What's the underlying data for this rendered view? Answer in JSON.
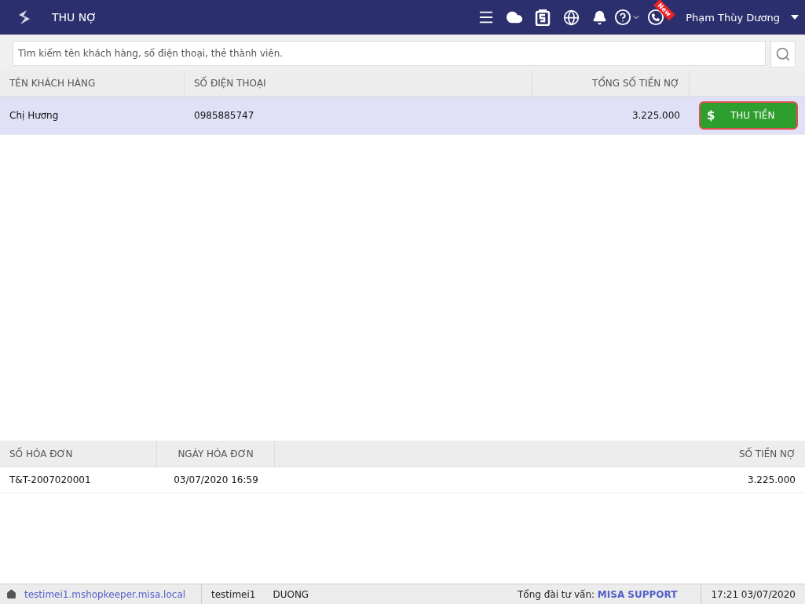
{
  "header": {
    "title": "THU NỢ",
    "new_badge": "New",
    "user_name": "Phạm Thùy Dương"
  },
  "search": {
    "placeholder": "Tìm kiếm tên khách hàng, số điện thoại, thẻ thành viên."
  },
  "customers": {
    "columns": [
      "TÊN KHÁCH HÀNG",
      "SỐ ĐIỆN THOẠI",
      "TỔNG SỐ TIỀN NỢ"
    ],
    "rows": [
      {
        "name": "Chị Hương",
        "phone": "0985885747",
        "total": "3.225.000",
        "selected": true,
        "action_symbol": "$",
        "action_label": "THU TIỀN"
      }
    ]
  },
  "invoices": {
    "columns": [
      "SỐ HÓA ĐƠN",
      "NGÀY HÓA ĐƠN",
      "SỐ TIỀN NỢ"
    ],
    "rows": [
      {
        "number": "T&T-2007020001",
        "date": "03/07/2020 16:59",
        "amount": "3.225.000"
      }
    ]
  },
  "status_bar": {
    "domain": "testimei1.mshopkeeper.misa.local",
    "user": "testimei1",
    "name": "DUONG",
    "hotline_label": "Tổng đài tư vấn:",
    "hotline_link": "MISA SUPPORT",
    "datetime": "17:21 03/07/2020"
  }
}
